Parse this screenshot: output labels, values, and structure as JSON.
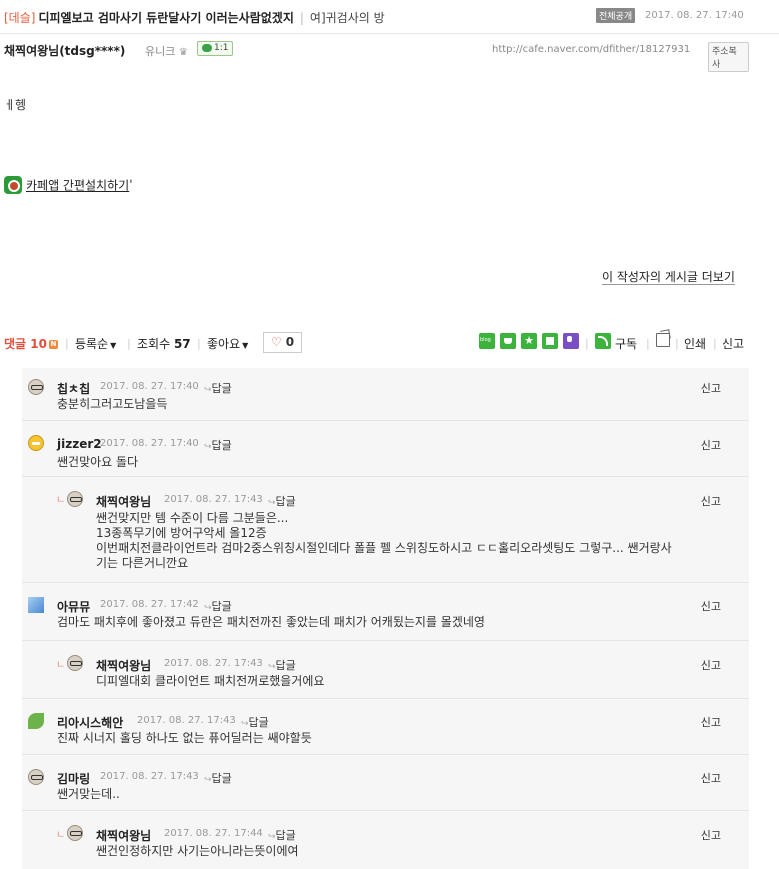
{
  "header": {
    "category": "[데슬]",
    "title": "디피엘보고 검마사기 듀란달사기 이러는사람없겠지",
    "board": "여]귀검사의 방",
    "public_badge": "전체공개",
    "date": "2017. 08. 27. 17:40"
  },
  "author": {
    "name": "채찍여왕님(tdsg****)",
    "grade": "유니크",
    "grade_icon": "crown-icon",
    "comment_badge": "1:1",
    "url": "http://cafe.naver.com/dfither/18127931",
    "copy_label": "주소복사"
  },
  "body": {
    "text": "ㅔ헹",
    "app_link": "카페앱 간편설치하기",
    "app_link_suffix": "'",
    "more_posts": "이 작성자의 게시글 더보기"
  },
  "toolbar": {
    "comments_label": "댓글",
    "comments_count": "10",
    "new_badge": "N",
    "sort_label": "등록순",
    "views_label": "조회수",
    "views_count": "57",
    "like_label": "좋아요",
    "like_heart": "♡",
    "like_count": "0",
    "subscribe_label": "구독",
    "print_label": "인쇄",
    "report_label": "신고"
  },
  "comments": [
    {
      "nick": "칩ㅊ칩",
      "date": "2017. 08. 27. 17:40",
      "reply": "답글",
      "report": "신고",
      "text": "충분히그러고도남을득",
      "avatar": "glasses-avatar-icon"
    },
    {
      "nick": "jizzer2",
      "date": "2017. 08. 27. 17:40",
      "reply": "답글",
      "report": "신고",
      "text": "쌘건맞아요 돌다",
      "avatar": "yellow-face-avatar-icon"
    },
    {
      "nick": "채찍여왕님",
      "date": "2017. 08. 27. 17:43",
      "reply": "답글",
      "report": "신고",
      "text": "쌘건맞지만 템 수준이 다름 그분들은...\n13종폭무기에 방어구악세 올12증\n이번패치전클라이언트라 검마2중스위칭시절인데다 폴플 펠 스위칭도하시고 ㄷㄷ홀리오라셋팅도 그렇구... 쌘거랑사\n기는 다른거니깐요",
      "avatar": "glasses-avatar-icon"
    },
    {
      "nick": "아뮤뮤",
      "date": "2017. 08. 27. 17:42",
      "reply": "답글",
      "report": "신고",
      "text": "검마도 패치후에 좋아졌고 듀란은 패치전까진 좋았는데 패치가 어캐됬는지를 몰겠네영",
      "avatar": "sky-avatar-icon"
    },
    {
      "nick": "채찍여왕님",
      "date": "2017. 08. 27. 17:43",
      "reply": "답글",
      "report": "신고",
      "text": "디피엘대회 클라이언트 패치전꺼로했을거에요",
      "avatar": "glasses-avatar-icon"
    },
    {
      "nick": "리아시스해안",
      "date": "2017. 08. 27. 17:43",
      "reply": "답글",
      "report": "신고",
      "text": "진짜 시너지 홀딩 하나도 없는 퓨어딜러는 쌔야할듯",
      "avatar": "leaf-avatar-icon"
    },
    {
      "nick": "김마링",
      "date": "2017. 08. 27. 17:43",
      "reply": "답글",
      "report": "신고",
      "text": "쌘거맞는데..",
      "avatar": "glasses-avatar-icon"
    },
    {
      "nick": "채찍여왕님",
      "date": "2017. 08. 27. 17:44",
      "reply": "답글",
      "report": "신고",
      "text": "쌘건인정하지만 사기는아니라는뜻이에여",
      "avatar": "glasses-avatar-icon"
    }
  ],
  "reply_mark": "ㄴ"
}
